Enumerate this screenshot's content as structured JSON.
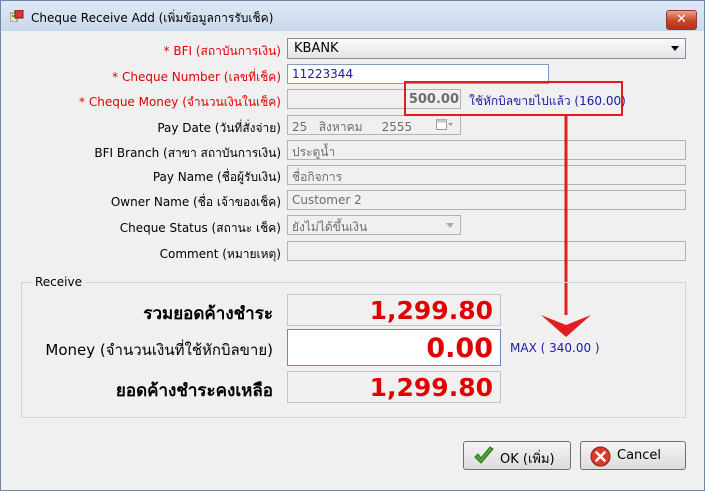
{
  "window": {
    "title": "Cheque Receive Add (เพิ่มข้อมูลการรับเช็ค)",
    "close_glyph": "✕"
  },
  "form": {
    "bfi": {
      "label": "BFI (สถาบันการเงิน)",
      "value": "KBANK"
    },
    "cheque_number": {
      "label": "Cheque Number (เลขที่เช็ค)",
      "value": "11223344"
    },
    "cheque_money": {
      "label": "Cheque Money (จำนวนเงินในเช็ค)",
      "value": "500.00"
    },
    "pay_date": {
      "label": "Pay Date (วันที่สั่งจ่าย)",
      "day": "25",
      "month": "สิงหาคม",
      "year": "2555"
    },
    "bfi_branch": {
      "label": "BFI Branch (สาขา สถาบันการเงิน)",
      "value": "ประตูน้ำ"
    },
    "pay_name": {
      "label": "Pay Name (ชื่อผู้รับเงิน)",
      "value": "ชื่อกิจการ"
    },
    "owner_name": {
      "label": "Owner Name (ชื่อ เจ้าของเช็ค)",
      "value": "Customer 2"
    },
    "cheque_status": {
      "label": "Cheque Status (สถานะ เช็ค)",
      "value": "ยังไม่ได้ขึ้นเงิน"
    },
    "comment": {
      "label": "Comment (หมายเหตุ)",
      "value": ""
    },
    "used_note": "ใช้หักบิลขายไปแล้ว (160.00)"
  },
  "receive": {
    "group_title": "Receive",
    "total_label": "รวมยอดค้างชำระ",
    "total_value": "1,299.80",
    "money_label": "Money (จำนวนเงินที่ใช้หักบิลขาย)",
    "money_value": "0.00",
    "max_text": "MAX ( 340.00 )",
    "remaining_label": "ยอดค้างชำระคงเหลือ",
    "remaining_value": "1,299.80"
  },
  "buttons": {
    "ok": "OK (เพิ่ม)",
    "cancel": "Cancel"
  },
  "colors": {
    "required_label": "#e00000",
    "annotation": "#e21d1d",
    "value_red": "#e00000",
    "link_blue": "#1a1aa6"
  }
}
